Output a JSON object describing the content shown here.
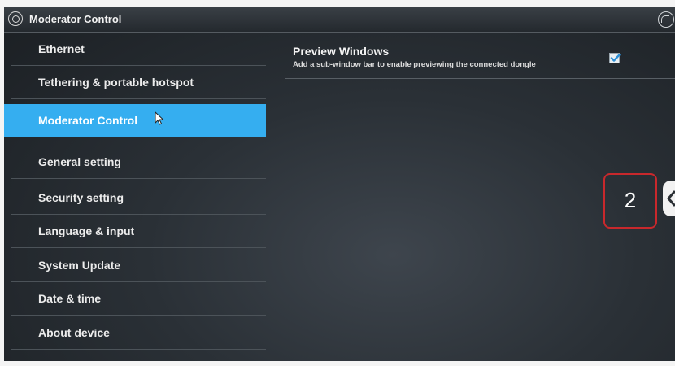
{
  "window": {
    "title": "Moderator Control",
    "app_icon": "settings-gear-icon",
    "top_right_icon": "back-arrow-icon"
  },
  "sidebar": {
    "selected_index": 2,
    "items": [
      {
        "label": "Ethernet"
      },
      {
        "label": "Tethering & portable hotspot"
      },
      {
        "label": "Moderator Control"
      },
      {
        "label": "General setting"
      },
      {
        "label": "Security setting"
      },
      {
        "label": "Language & input"
      },
      {
        "label": "System Update"
      },
      {
        "label": "Date & time"
      },
      {
        "label": "About device"
      }
    ]
  },
  "main": {
    "preference": {
      "title": "Preview Windows",
      "summary": "Add a sub-window bar to enable previewing the connected dongle",
      "checked": true
    }
  },
  "annotation": {
    "step_number": "2"
  },
  "edge_tab": {
    "icon": "chevron-left-icon"
  },
  "colors": {
    "accent": "#35aef0",
    "annotation_border": "#c8282c"
  }
}
